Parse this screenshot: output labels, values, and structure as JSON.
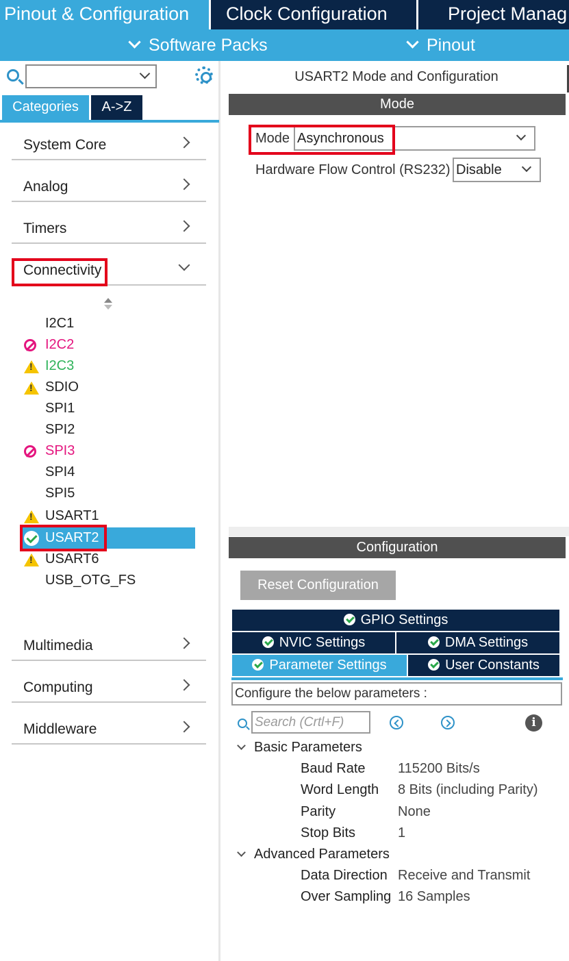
{
  "top_tabs": [
    "Pinout & Configuration",
    "Clock Configuration",
    "Project Manag"
  ],
  "subbar": {
    "software_packs": "Software Packs",
    "pinout": "Pinout"
  },
  "left": {
    "tabs": {
      "categories": "Categories",
      "az": "A->Z"
    },
    "categories_top": [
      "System Core",
      "Analog",
      "Timers",
      "Connectivity"
    ],
    "peripherals": [
      {
        "name": "I2C1",
        "status": "none"
      },
      {
        "name": "I2C2",
        "status": "blocked"
      },
      {
        "name": "I2C3",
        "status": "warning"
      },
      {
        "name": "SDIO",
        "status": "warning"
      },
      {
        "name": "SPI1",
        "status": "none"
      },
      {
        "name": "SPI2",
        "status": "none"
      },
      {
        "name": "SPI3",
        "status": "blocked"
      },
      {
        "name": "SPI4",
        "status": "none"
      },
      {
        "name": "SPI5",
        "status": "none"
      },
      {
        "name": "USART1",
        "status": "warning"
      },
      {
        "name": "USART2",
        "status": "ok-selected"
      },
      {
        "name": "USART6",
        "status": "warning"
      },
      {
        "name": "USB_OTG_FS",
        "status": "none"
      }
    ],
    "categories_bottom": [
      "Multimedia",
      "Computing",
      "Middleware"
    ]
  },
  "mode": {
    "title": "USART2 Mode and Configuration",
    "section": "Mode",
    "mode_label": "Mode",
    "mode_value": "Asynchronous",
    "hwflow_label": "Hardware Flow Control (RS232)",
    "hwflow_value": "Disable"
  },
  "config": {
    "section": "Configuration",
    "reset_button": "Reset Configuration",
    "tabs": {
      "gpio": "GPIO Settings",
      "nvic": "NVIC Settings",
      "dma": "DMA Settings",
      "param": "Parameter Settings",
      "user": "User Constants"
    },
    "description": "Configure the below parameters :",
    "search_placeholder": "Search (Crtl+F)",
    "groups": [
      {
        "title": "Basic Parameters",
        "params": [
          {
            "name": "Baud Rate",
            "value": "115200 Bits/s"
          },
          {
            "name": "Word Length",
            "value": "8 Bits (including Parity)"
          },
          {
            "name": "Parity",
            "value": "None"
          },
          {
            "name": "Stop Bits",
            "value": "1"
          }
        ]
      },
      {
        "title": "Advanced Parameters",
        "params": [
          {
            "name": "Data Direction",
            "value": "Receive and Transmit"
          },
          {
            "name": "Over Sampling",
            "value": "16 Samples"
          }
        ]
      }
    ]
  },
  "colors": {
    "accent": "#39a9db",
    "navy": "#0a2547",
    "highlight": "#e3001b",
    "blocked": "#e4157e",
    "warning": "#f5c400",
    "ok": "#2aa84a"
  }
}
